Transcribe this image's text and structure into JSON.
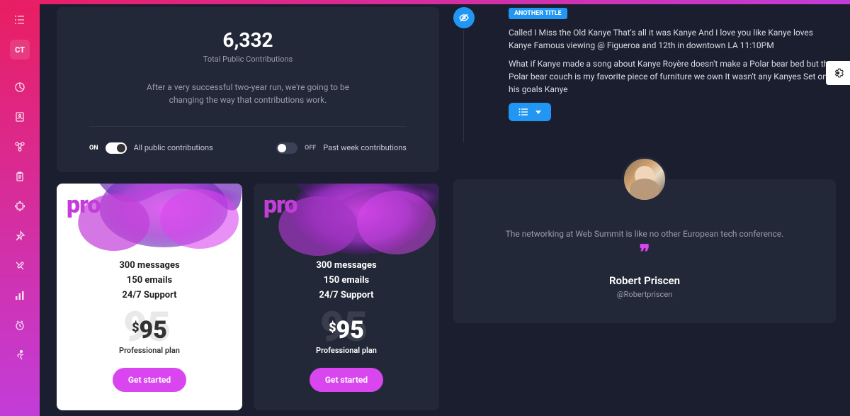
{
  "sidebar": {
    "brand": "CT",
    "icons": [
      "pie-chart-icon",
      "users-icon",
      "connections-icon",
      "clipboard-icon",
      "puzzle-icon",
      "pin-icon",
      "tools-icon",
      "bar-chart-icon",
      "clock-icon",
      "running-icon"
    ]
  },
  "contrib": {
    "value": "6,332",
    "label": "Total Public Contributions",
    "desc": "After a very successful two-year run, we're going to be changing the way that contributions work.",
    "toggle_on_txt": "ON",
    "toggle_on_label": "All public contributions",
    "toggle_off_txt": "OFF",
    "toggle_off_label": "Past week contributions"
  },
  "pricing": {
    "pro": "pro",
    "feat1": "300 messages",
    "feat2": "150 emails",
    "feat3": "24/7 Support",
    "currency": "$",
    "price": "95",
    "ghost": "95",
    "plan": "Professional plan",
    "cta": "Get started"
  },
  "timeline": {
    "badge": "ANOTHER TITLE",
    "p1": "Called I Miss the Old Kanye That's all it was Kanye And I love you like Kanye loves Kanye Famous viewing @ Figueroa and 12th in downtown LA 11:10PM",
    "p2": "What if Kanye made a song about Kanye Royère doesn't make a Polar bear bed but the Polar bear couch is my favorite piece of furniture we own It wasn't any Kanyes Set on his goals Kanye"
  },
  "testimonial": {
    "text": "The networking at Web Summit is like no other European tech conference.",
    "name": "Robert Priscen",
    "handle": "@Robertpriscen"
  }
}
